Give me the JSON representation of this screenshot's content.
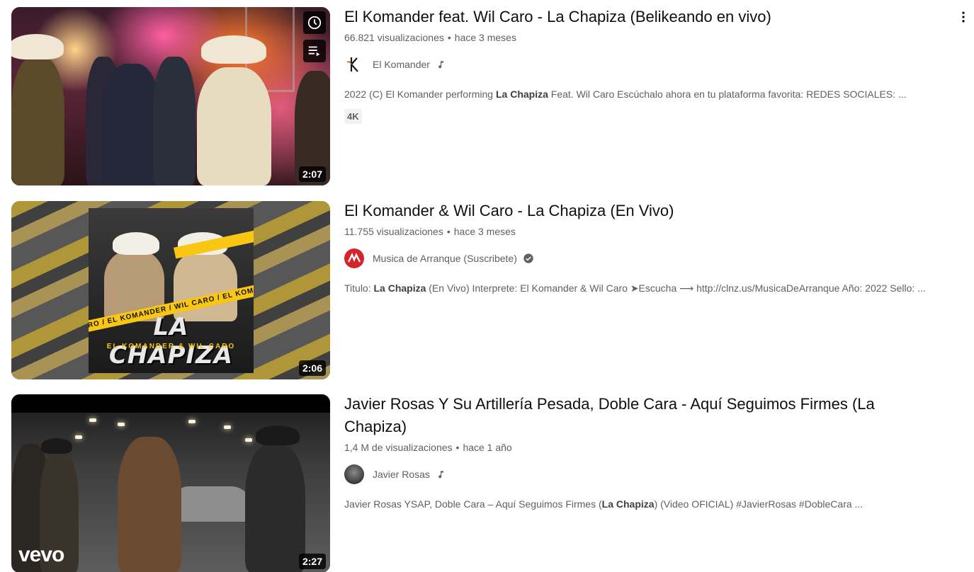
{
  "results": [
    {
      "title": "El Komander feat. Wil Caro - La Chapiza (Belikeando en vivo)",
      "views": "66.821 visualizaciones",
      "age": "hace 3 meses",
      "channel": "El Komander",
      "channel_badge": "music-note-icon",
      "snippet_pre": "2022 (C) El Komander performing ",
      "snippet_bold": "La Chapiza",
      "snippet_post": " Feat. Wil Caro Escúchalo ahora en tu plataforma favorita: REDES SOCIALES: ...",
      "tag": "4K",
      "duration": "2:07"
    },
    {
      "title": "El Komander & Wil Caro - La Chapiza (En Vivo)",
      "views": "11.755 visualizaciones",
      "age": "hace 3 meses",
      "channel": "Musica de Arranque (Suscribete)",
      "channel_badge": "verified-check-icon",
      "snippet_pre": "Titulo: ",
      "snippet_bold": "La Chapiza",
      "snippet_post": " (En Vivo) Interprete: El Komander & Wil Caro ➤Escucha ⟶ http://clnz.us/MusicaDeArranque Año: 2022 Sello: ...",
      "duration": "2:06",
      "cover_title": "LA CHAPIZA",
      "cover_subtitle": "EL KOMANDER & WIL CARO",
      "cover_band": "CARO / EL KOMANDER / WIL CARO / EL KOMANDER"
    },
    {
      "title": "Javier Rosas Y Su Artillería Pesada, Doble Cara - Aquí Seguimos Firmes (La Chapiza)",
      "views": "1,4 M de visualizaciones",
      "age": "hace 1 año",
      "channel": "Javier Rosas",
      "channel_badge": "music-note-icon",
      "snippet_pre": "Javier Rosas YSAP, Doble Cara – Aquí Seguimos Firmes (",
      "snippet_bold": "La Chapiza",
      "snippet_post": ") (Video OFICIAL) #JavierRosas #DobleCara ...",
      "duration": "2:27",
      "watermark": "vevo"
    }
  ],
  "dot": "•",
  "icons": {
    "watch_later": "clock-icon",
    "add_to_queue": "queue-icon",
    "more": "more-vert-icon"
  },
  "colors": {
    "title": "#0f0f0f",
    "meta": "#606060",
    "overlay": "#000000"
  }
}
